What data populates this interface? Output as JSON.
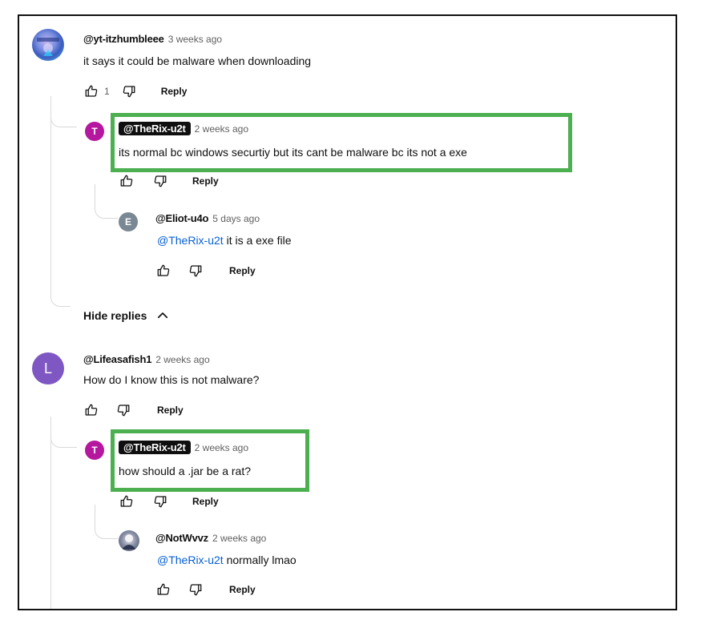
{
  "comments": [
    {
      "handle": "@yt-itzhumbleee",
      "time": "3 weeks ago",
      "text": "it says it could be malware when downloading",
      "likes": "1",
      "reply_label": "Reply"
    },
    {
      "handle": "@TheRix-u2t",
      "avatar_letter": "T",
      "avatar_color": "#b5179e",
      "time": "2 weeks ago",
      "text": "its normal bc windows securtiy but its cant be malware bc its not a exe",
      "reply_label": "Reply"
    },
    {
      "handle": "@Eliot-u4o",
      "avatar_letter": "E",
      "avatar_color": "#7a8895",
      "time": "5 days ago",
      "mention": "@TheRix-u2t",
      "text": " it is a exe file",
      "reply_label": "Reply"
    },
    {
      "handle": "@Lifeasafish1",
      "avatar_letter": "L",
      "avatar_color": "#7e57c2",
      "time": "2 weeks ago",
      "text": "How do I know this is not malware?",
      "reply_label": "Reply"
    },
    {
      "handle": "@TheRix-u2t",
      "avatar_letter": "T",
      "avatar_color": "#b5179e",
      "time": "2 weeks ago",
      "text": "how should a .jar be a rat?",
      "reply_label": "Reply"
    },
    {
      "handle": "@NotWvvz",
      "time": "2 weeks ago",
      "mention": "@TheRix-u2t",
      "text": " normally lmao",
      "reply_label": "Reply"
    }
  ],
  "hide_replies_label": "Hide replies",
  "highlight_color": "#4caf50",
  "icons": [
    "thumbs-up-icon",
    "thumbs-down-icon",
    "chevron-up-icon"
  ]
}
